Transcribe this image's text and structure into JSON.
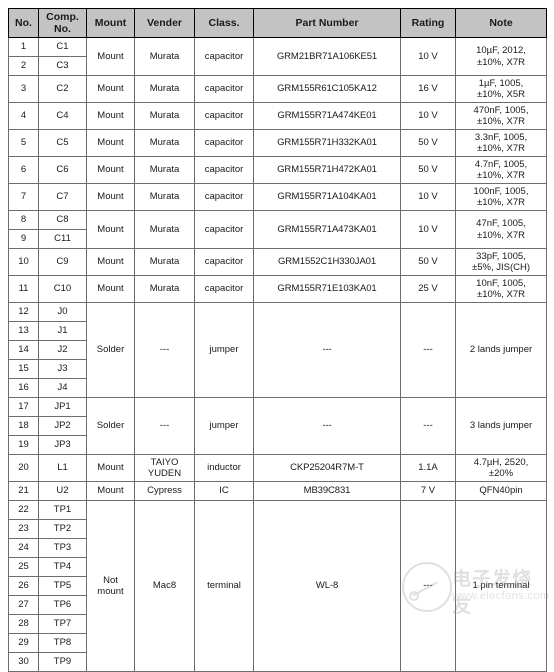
{
  "table": {
    "columns": [
      {
        "key": "no",
        "label": "No."
      },
      {
        "key": "comp",
        "label": "Comp.\nNo."
      },
      {
        "key": "mount",
        "label": "Mount"
      },
      {
        "key": "vender",
        "label": "Vender"
      },
      {
        "key": "class",
        "label": "Class."
      },
      {
        "key": "part",
        "label": "Part Number"
      },
      {
        "key": "rating",
        "label": "Rating"
      },
      {
        "key": "note",
        "label": "Note"
      }
    ],
    "groups": [
      {
        "rows": [
          {
            "no": "1",
            "comp": "C1"
          },
          {
            "no": "2",
            "comp": "C3"
          }
        ],
        "mount": "Mount",
        "vender": "Murata",
        "class": "capacitor",
        "part": "GRM21BR71A106KE51",
        "rating": "10 V",
        "note": "10µF, 2012,\n±10%, X7R"
      },
      {
        "rows": [
          {
            "no": "3",
            "comp": "C2"
          }
        ],
        "mount": "Mount",
        "vender": "Murata",
        "class": "capacitor",
        "part": "GRM155R61C105KA12",
        "rating": "16 V",
        "note": "1µF, 1005,\n±10%, X5R"
      },
      {
        "rows": [
          {
            "no": "4",
            "comp": "C4"
          }
        ],
        "mount": "Mount",
        "vender": "Murata",
        "class": "capacitor",
        "part": "GRM155R71A474KE01",
        "rating": "10 V",
        "note": "470nF, 1005,\n±10%, X7R"
      },
      {
        "rows": [
          {
            "no": "5",
            "comp": "C5"
          }
        ],
        "mount": "Mount",
        "vender": "Murata",
        "class": "capacitor",
        "part": "GRM155R71H332KA01",
        "rating": "50 V",
        "note": "3.3nF, 1005,\n±10%, X7R"
      },
      {
        "rows": [
          {
            "no": "6",
            "comp": "C6"
          }
        ],
        "mount": "Mount",
        "vender": "Murata",
        "class": "capacitor",
        "part": "GRM155R71H472KA01",
        "rating": "50 V",
        "note": "4.7nF, 1005,\n±10%, X7R"
      },
      {
        "rows": [
          {
            "no": "7",
            "comp": "C7"
          }
        ],
        "mount": "Mount",
        "vender": "Murata",
        "class": "capacitor",
        "part": "GRM155R71A104KA01",
        "rating": "10 V",
        "note": "100nF, 1005,\n±10%, X7R"
      },
      {
        "rows": [
          {
            "no": "8",
            "comp": "C8"
          },
          {
            "no": "9",
            "comp": "C11"
          }
        ],
        "mount": "Mount",
        "vender": "Murata",
        "class": "capacitor",
        "part": "GRM155R71A473KA01",
        "rating": "10 V",
        "note": "47nF, 1005,\n±10%, X7R"
      },
      {
        "rows": [
          {
            "no": "10",
            "comp": "C9"
          }
        ],
        "mount": "Mount",
        "vender": "Murata",
        "class": "capacitor",
        "part": "GRM1552C1H330JA01",
        "rating": "50 V",
        "note": "33pF, 1005,\n±5%, JIS(CH)"
      },
      {
        "rows": [
          {
            "no": "11",
            "comp": "C10"
          }
        ],
        "mount": "Mount",
        "vender": "Murata",
        "class": "capacitor",
        "part": "GRM155R71E103KA01",
        "rating": "25 V",
        "note": "10nF, 1005,\n±10%, X7R"
      },
      {
        "rows": [
          {
            "no": "12",
            "comp": "J0"
          },
          {
            "no": "13",
            "comp": "J1"
          },
          {
            "no": "14",
            "comp": "J2"
          },
          {
            "no": "15",
            "comp": "J3"
          },
          {
            "no": "16",
            "comp": "J4"
          }
        ],
        "mount": "Solder",
        "vender": "---",
        "class": "jumper",
        "part": "---",
        "rating": "---",
        "note": "2 lands jumper"
      },
      {
        "rows": [
          {
            "no": "17",
            "comp": "JP1"
          },
          {
            "no": "18",
            "comp": "JP2"
          },
          {
            "no": "19",
            "comp": "JP3"
          }
        ],
        "mount": "Solder",
        "vender": "---",
        "class": "jumper",
        "part": "---",
        "rating": "---",
        "note": "3 lands jumper"
      },
      {
        "rows": [
          {
            "no": "20",
            "comp": "L1"
          }
        ],
        "mount": "Mount",
        "vender": "TAIYO\nYUDEN",
        "class": "inductor",
        "part": "CKP25204R7M-T",
        "rating": "1.1A",
        "note": "4.7µH, 2520,\n±20%"
      },
      {
        "rows": [
          {
            "no": "21",
            "comp": "U2"
          }
        ],
        "mount": "Mount",
        "vender": "Cypress",
        "class": "IC",
        "part": "MB39C831",
        "rating": "7 V",
        "note": "QFN40pin"
      },
      {
        "rows": [
          {
            "no": "22",
            "comp": "TP1"
          },
          {
            "no": "23",
            "comp": "TP2"
          },
          {
            "no": "24",
            "comp": "TP3"
          },
          {
            "no": "25",
            "comp": "TP4"
          },
          {
            "no": "26",
            "comp": "TP5"
          },
          {
            "no": "27",
            "comp": "TP6"
          },
          {
            "no": "28",
            "comp": "TP7"
          },
          {
            "no": "29",
            "comp": "TP8"
          },
          {
            "no": "30",
            "comp": "TP9"
          }
        ],
        "mount": "Not\nmount",
        "vender": "Mac8",
        "class": "terminal",
        "part": "WL-8",
        "rating": "---",
        "note": "1 pin terminal"
      }
    ]
  },
  "watermark": {
    "brand": "电子发烧友",
    "url": "www.elecfans.com"
  },
  "colors": {
    "header_bg": "#c3c3c3",
    "border": "#6e6e6e",
    "outer_border": "#000000",
    "text": "#1a1a1a",
    "watermark": "#9a9a9a"
  }
}
